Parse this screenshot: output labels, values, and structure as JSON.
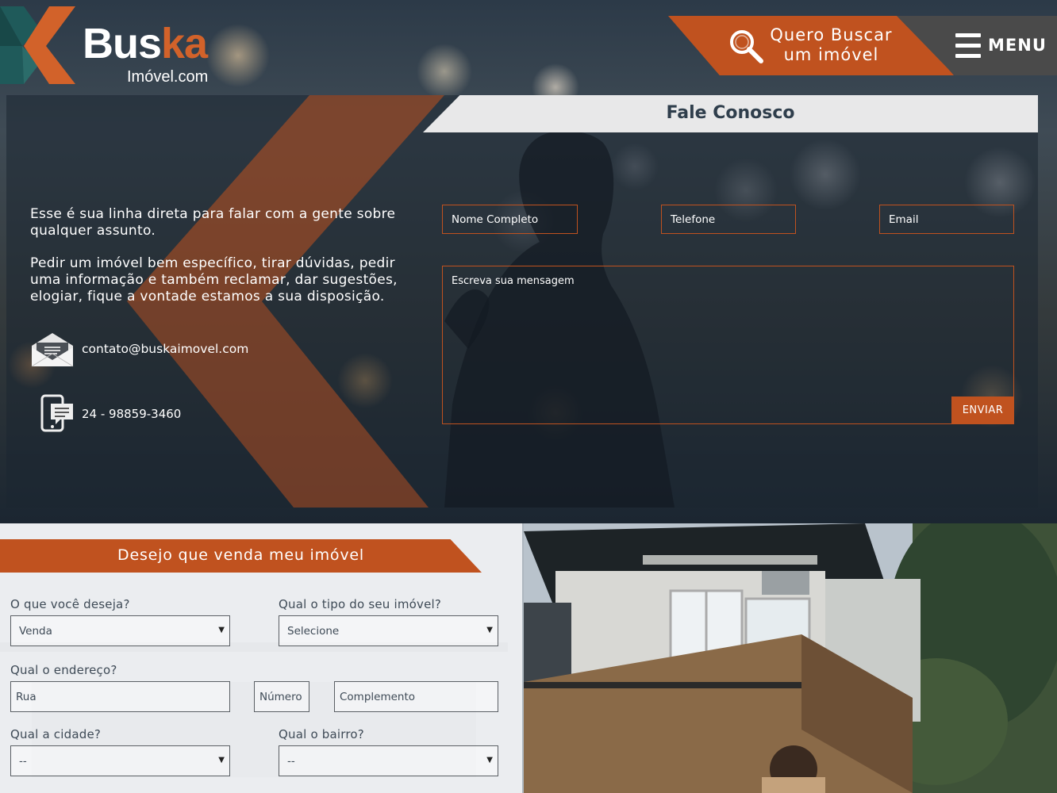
{
  "header": {
    "logo": {
      "main": "Bus",
      "accent": "ka",
      "sub": "Imóvel.com"
    },
    "search_button": {
      "line1": "Quero Buscar",
      "line2": "um imóvel",
      "icon": "search-icon"
    },
    "menu_button": {
      "label": "MENU",
      "icon": "hamburger-icon"
    }
  },
  "contact": {
    "title": "Fale Conosco",
    "paragraph1": "Esse é sua linha direta para falar com a gente sobre qualquer assunto.",
    "paragraph2": "Pedir um imóvel bem específico, tirar dúvidas, pedir uma informação e também reclamar, dar sugestões, elogiar, fique a vontade estamos a sua disposição.",
    "email": "contato@buskaimovel.com",
    "phone": "24 - 98859-3460",
    "form": {
      "name_placeholder": "Nome Completo",
      "phone_placeholder": "Telefone",
      "email_placeholder": "Email",
      "message_placeholder": "Escreva sua mensagem",
      "submit_label": "ENVIAR"
    }
  },
  "sell_form": {
    "title": "Desejo que venda meu imóvel",
    "fields": {
      "desire_label": "O que você deseja?",
      "desire_value": "Venda",
      "type_label": "Qual o tipo do seu imóvel?",
      "type_value": "Selecione",
      "address_label": "Qual o endereço?",
      "street_placeholder": "Rua",
      "number_placeholder": "Número",
      "complement_placeholder": "Complemento",
      "city_label": "Qual a cidade?",
      "city_value": "--",
      "district_label": "Qual o bairro?",
      "district_value": "--"
    }
  },
  "colors": {
    "accent": "#c0521f",
    "dark_text": "#2f3e4c",
    "menu_bg": "#4a4a4a"
  }
}
